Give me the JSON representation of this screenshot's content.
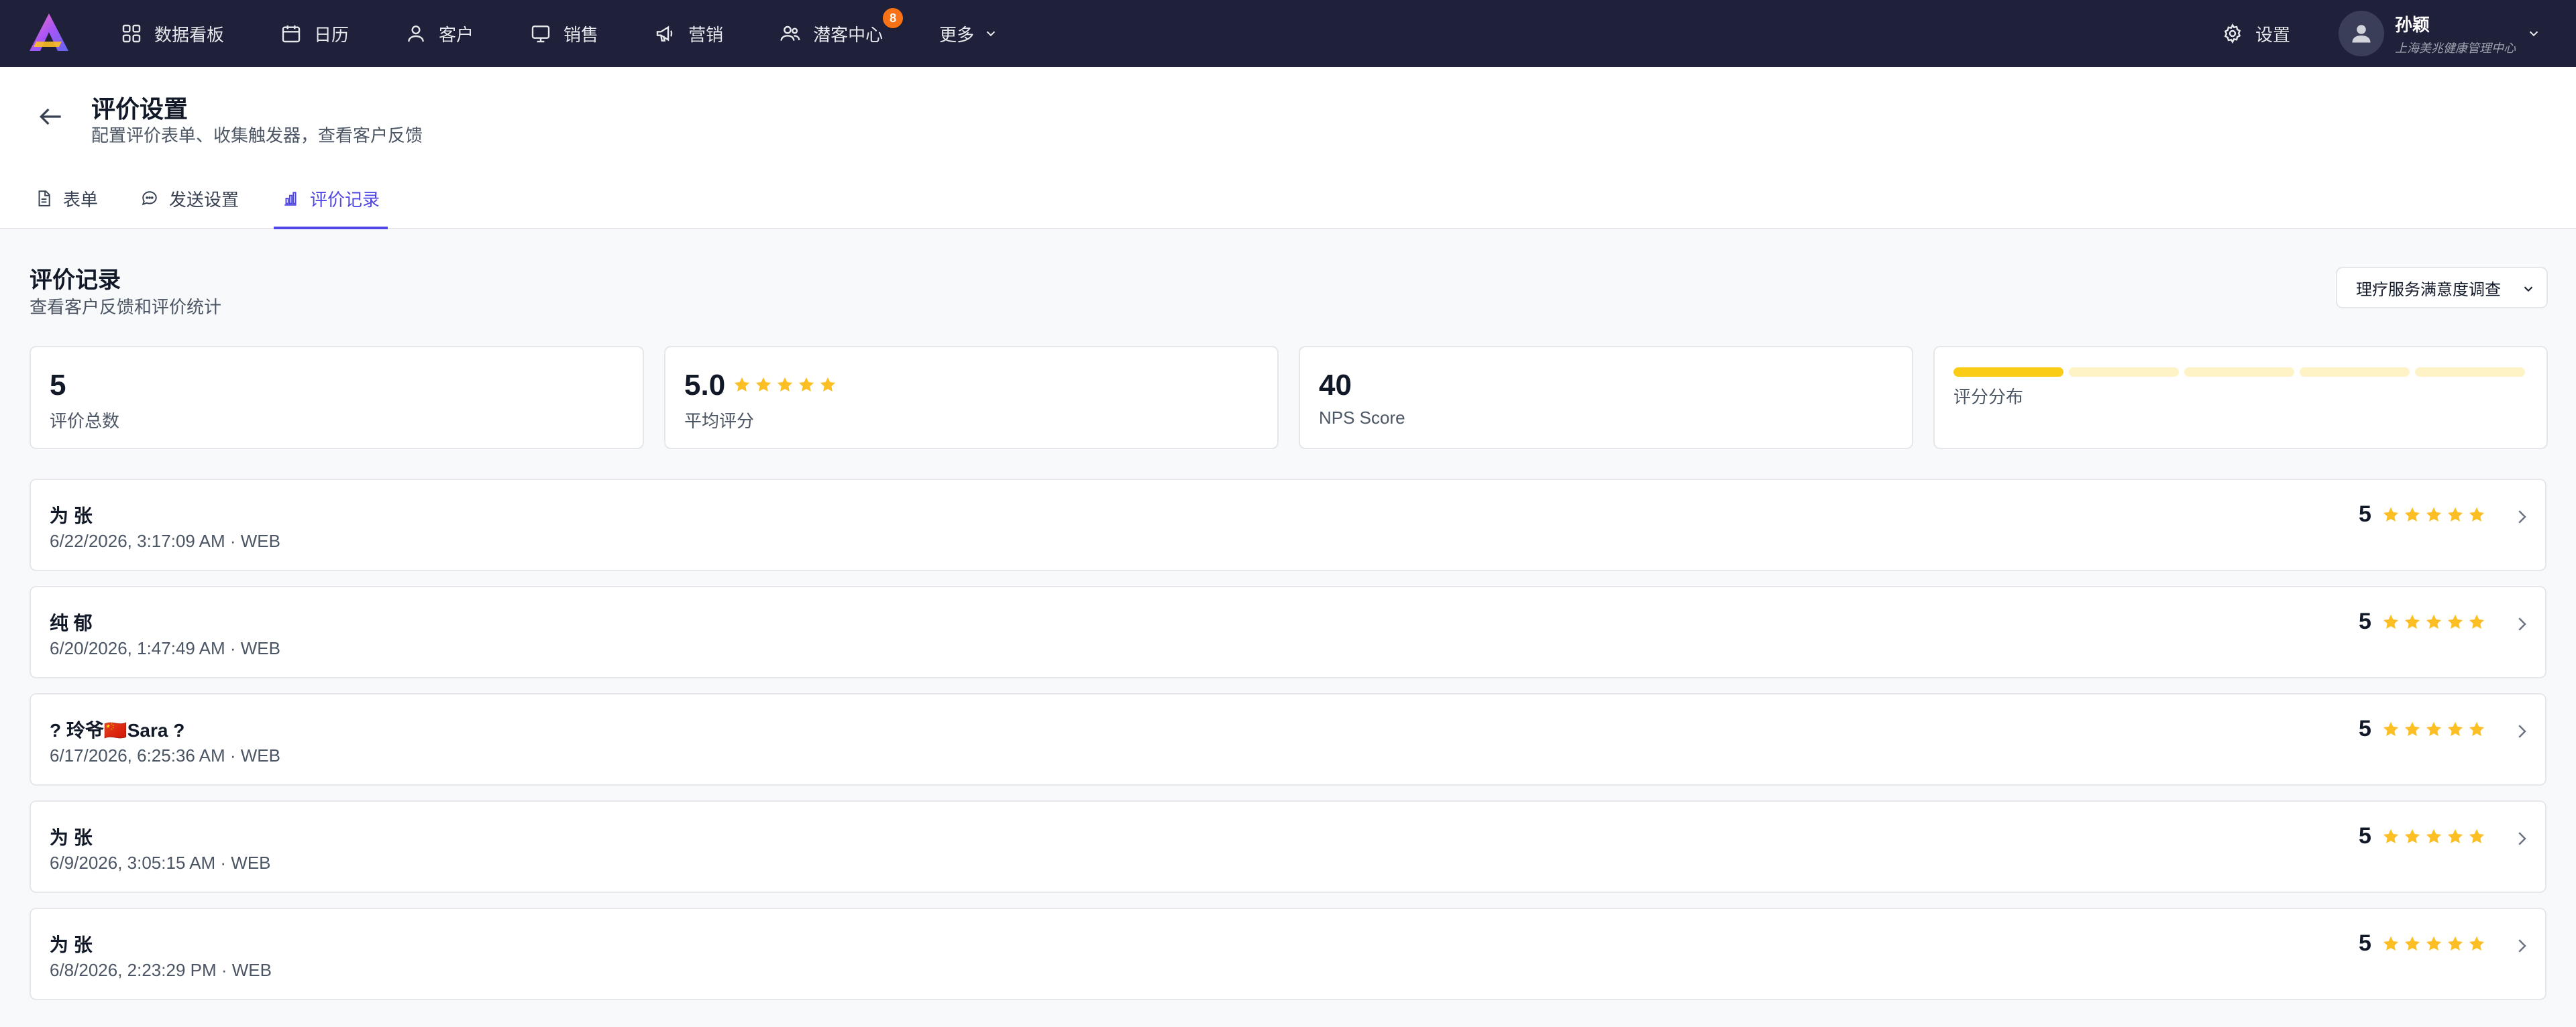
{
  "nav": {
    "items": [
      {
        "label": "数据看板",
        "icon": "dashboard-icon"
      },
      {
        "label": "日历",
        "icon": "calendar-icon"
      },
      {
        "label": "客户",
        "icon": "user-icon"
      },
      {
        "label": "销售",
        "icon": "monitor-icon"
      },
      {
        "label": "营销",
        "icon": "megaphone-icon"
      },
      {
        "label": "潜客中心",
        "icon": "users-icon",
        "badge": "8"
      }
    ],
    "more_label": "更多",
    "settings_label": "设置",
    "user_name": "孙颖",
    "user_org": "上海美兆健康管理中心",
    "badge_color": "#f97316"
  },
  "header": {
    "title": "评价设置",
    "subtitle": "配置评价表单、收集触发器，查看客户反馈",
    "tabs": [
      {
        "label": "表单",
        "icon": "document-icon",
        "active": false
      },
      {
        "label": "发送设置",
        "icon": "chat-icon",
        "active": false
      },
      {
        "label": "评价记录",
        "icon": "bar-chart-icon",
        "active": true
      }
    ],
    "accent_color": "#4f46e5"
  },
  "section": {
    "title": "评价记录",
    "subtitle": "查看客户反馈和评价统计",
    "survey_select": "理疗服务满意度调查"
  },
  "stats": {
    "total_value": "5",
    "total_label": "评价总数",
    "avg_value": "5.0",
    "avg_label": "平均评分",
    "avg_stars": 5,
    "nps_value": "40",
    "nps_label": "NPS Score",
    "dist_label": "评分分布",
    "distribution": [
      1.0,
      0,
      0,
      0,
      0
    ],
    "star_color": "#fbbf24"
  },
  "records": [
    {
      "name": "为 张",
      "meta": "6/22/2026, 3:17:09 AM · WEB",
      "score": "5",
      "stars": 5
    },
    {
      "name": "纯 郁",
      "meta": "6/20/2026, 1:47:49 AM · WEB",
      "score": "5",
      "stars": 5
    },
    {
      "name": "? 玲爷🇨🇳Sara ?",
      "meta": "6/17/2026, 6:25:36 AM · WEB",
      "score": "5",
      "stars": 5
    },
    {
      "name": "为 张",
      "meta": "6/9/2026, 3:05:15 AM · WEB",
      "score": "5",
      "stars": 5
    },
    {
      "name": "为 张",
      "meta": "6/8/2026, 2:23:29 PM · WEB",
      "score": "5",
      "stars": 5
    }
  ]
}
